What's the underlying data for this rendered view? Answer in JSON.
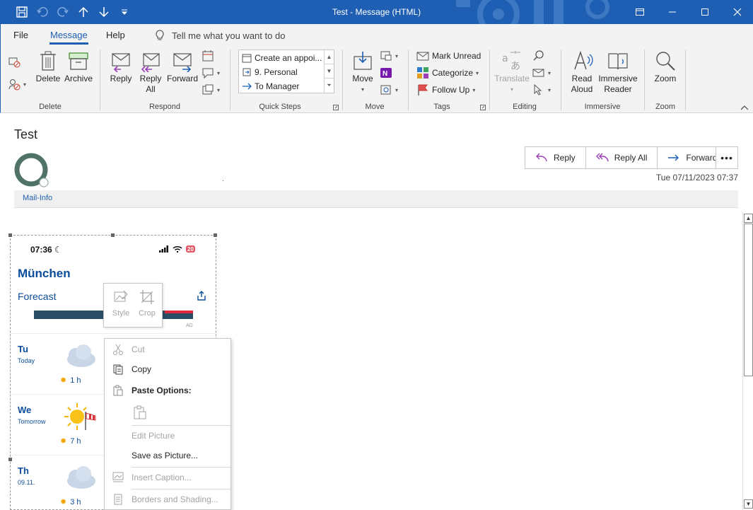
{
  "window": {
    "title": "Test  -  Message (HTML)",
    "accent": "#1e5fb4"
  },
  "tabs": {
    "file": "File",
    "message": "Message",
    "help": "Help",
    "tell_me": "Tell me what you want to do"
  },
  "ribbon": {
    "delete_group": {
      "delete": "Delete",
      "archive": "Archive",
      "label": "Delete"
    },
    "respond_group": {
      "reply": "Reply",
      "reply_all_1": "Reply",
      "reply_all_2": "All",
      "forward": "Forward",
      "label": "Respond"
    },
    "quick_steps": {
      "items": [
        "Create an appoi...",
        "9. Personal",
        "To Manager"
      ],
      "label": "Quick Steps"
    },
    "move_group": {
      "move": "Move",
      "label": "Move"
    },
    "tags_group": {
      "mark_unread": "Mark Unread",
      "categorize": "Categorize",
      "follow_up": "Follow Up",
      "label": "Tags"
    },
    "editing_group": {
      "translate": "Translate",
      "label": "Editing"
    },
    "immersive_group": {
      "read_aloud_1": "Read",
      "read_aloud_2": "Aloud",
      "reader_1": "Immersive",
      "reader_2": "Reader",
      "label": "Immersive"
    },
    "zoom_group": {
      "zoom": "Zoom",
      "label": "Zoom"
    }
  },
  "message": {
    "subject": "Test",
    "separator": ".",
    "date": "Tue 07/11/2023 07:37",
    "mail_info": "Mail-Info",
    "actions": {
      "reply": "Reply",
      "reply_all": "Reply All",
      "forward": "Forward",
      "more": "•••"
    }
  },
  "phone": {
    "time": "07:36",
    "battery": "20",
    "city": "München",
    "forecast": "Forecast",
    "ad_tag": "AD",
    "days": [
      {
        "day": "Tu",
        "sub": "Today",
        "sun": "1 h"
      },
      {
        "day": "We",
        "sub": "Tomorrow",
        "sun": "7 h"
      },
      {
        "day": "Th",
        "sub": "09.11.",
        "sun": "3 h"
      }
    ]
  },
  "mini_toolbar": {
    "style": "Style",
    "crop": "Crop"
  },
  "context_menu": {
    "cut": "Cut",
    "copy": "Copy",
    "paste_options": "Paste Options:",
    "edit_picture": "Edit Picture",
    "save_as_picture": "Save as Picture...",
    "insert_caption": "Insert Caption...",
    "borders_shading": "Borders and Shading..."
  }
}
